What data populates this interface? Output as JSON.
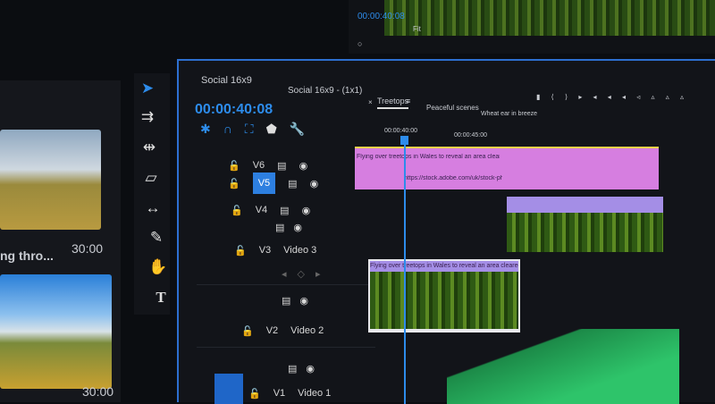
{
  "program_monitor": {
    "timecode": "00:00:40:08",
    "zoom": "Fit"
  },
  "project_panel": {
    "items": [
      {
        "name": "ng thro...",
        "duration": "30:00"
      },
      {
        "name": "",
        "duration": "30:00"
      }
    ]
  },
  "tools": [
    "selection-tool",
    "track-select-tool",
    "ripple-edit-tool",
    "razor-tool",
    "slip-tool",
    "pen-tool",
    "hand-tool",
    "type-tool"
  ],
  "timeline": {
    "sequence_tabs": [
      "Social 16x9",
      "Social 16x9 - (1x1)"
    ],
    "timecode": "00:00:40:08",
    "tabs": [
      {
        "label": "Treetops",
        "active": true
      },
      {
        "label": "Peaceful scenes"
      },
      {
        "label": "Wheat ear in breeze"
      }
    ],
    "ruler": [
      "00:00:40:00",
      "00:00:45:00"
    ],
    "tracks": [
      {
        "id": "V6",
        "name": ""
      },
      {
        "id": "V5",
        "name": "",
        "selected": true
      },
      {
        "id": "V4",
        "name": ""
      },
      {
        "id": "V3",
        "name": "Video 3"
      },
      {
        "id": "V2",
        "name": "Video 2"
      },
      {
        "id": "V1",
        "name": "Video 1"
      }
    ],
    "clips": {
      "title_clip": "Flying over treetops in Wales to reveal an area cleared for forest management",
      "url_clip": "https://stock.adobe.com/uk/stock-photo/",
      "v2_clip": "Flying over treetops in Wales to reveal an area cleared for forest management"
    }
  },
  "colors": {
    "accent": "#2d8ceb",
    "title_clip": "#d67ee0",
    "video_clip": "#a48ee6",
    "audio": "#2ec46a"
  }
}
